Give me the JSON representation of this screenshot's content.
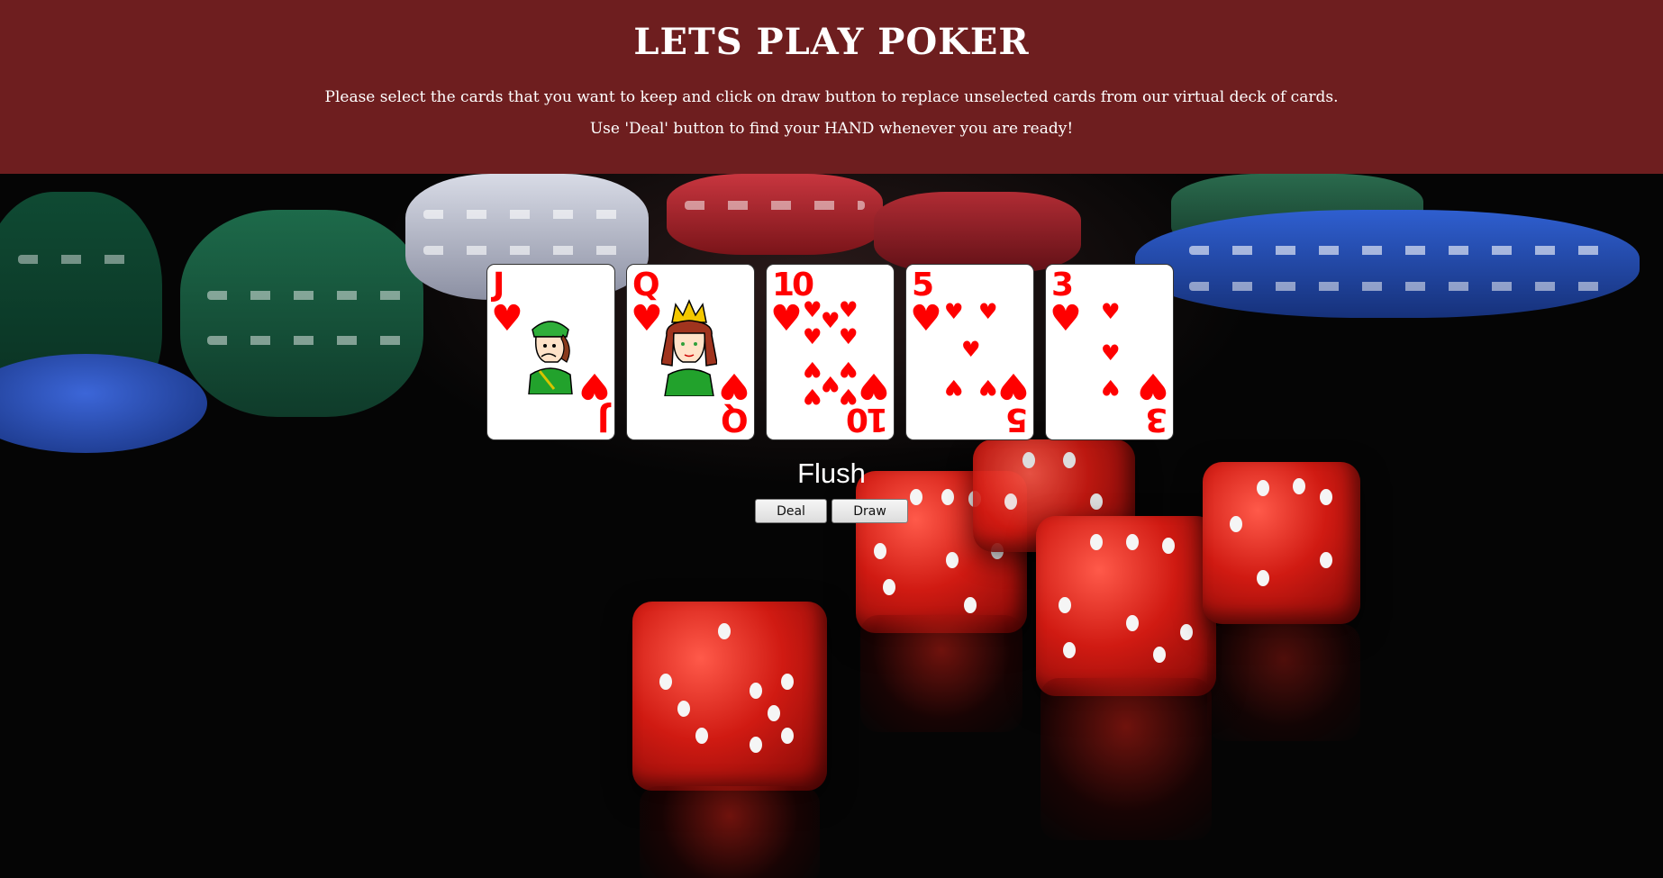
{
  "header": {
    "title": "LETS PLAY POKER",
    "instructions_line1": "Please select the cards that you want to keep and click on draw button to replace unselected cards from our virtual deck of cards.",
    "instructions_line2": "Use 'Deal' button to find your HAND whenever you are ready!"
  },
  "hand": {
    "cards": [
      {
        "rank": "J",
        "suit": "hearts",
        "suit_glyph": "♥"
      },
      {
        "rank": "Q",
        "suit": "hearts",
        "suit_glyph": "♥"
      },
      {
        "rank": "10",
        "suit": "hearts",
        "suit_glyph": "♥"
      },
      {
        "rank": "5",
        "suit": "hearts",
        "suit_glyph": "♥"
      },
      {
        "rank": "3",
        "suit": "hearts",
        "suit_glyph": "♥"
      }
    ],
    "result": "Flush"
  },
  "controls": {
    "deal_label": "Deal",
    "draw_label": "Draw"
  },
  "colors": {
    "header_bg": "#6e1e1f",
    "suit_red": "#ff0000"
  }
}
